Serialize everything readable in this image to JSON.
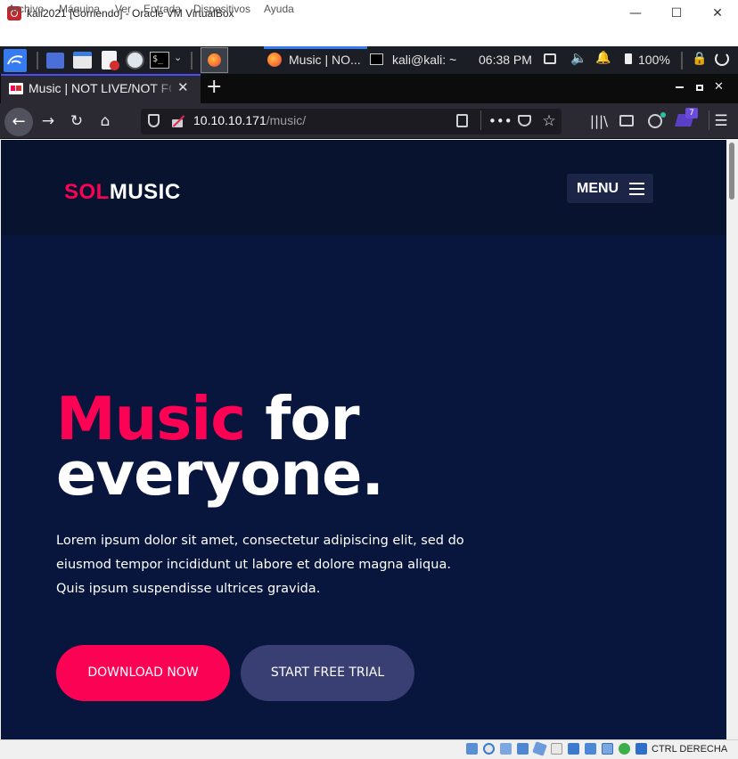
{
  "virtualbox": {
    "title": "kali2021 [Corriendo] - Oracle VM VirtualBox",
    "menu": [
      "Archivo",
      "Máquina",
      "Ver",
      "Entrada",
      "Dispositivos",
      "Ayuda"
    ],
    "host_key_label": "CTRL DERECHA"
  },
  "panel": {
    "task_firefox": "Music | NO...",
    "task_terminal": "kali@kali: ~",
    "clock": "06:38 PM",
    "battery": "100%",
    "notification_count": "7"
  },
  "browser": {
    "tab_title": "Music | NOT LIVE/NOT FOR PRODUCTION USE",
    "url_host": "10.10.10.171",
    "url_path": "/music/"
  },
  "site": {
    "logo_part1": "SOL",
    "logo_part2": "MUSIC",
    "menu_label": "MENU",
    "hero_highlight": "Music",
    "hero_title_rest1": " for",
    "hero_title_rest2": "everyone.",
    "hero_description": "Lorem ipsum dolor sit amet, consectetur adipiscing elit, sed do eiusmod tempor incididunt ut labore et dolore magna aliqua. Quis ipsum suspendisse ultrices gravida.",
    "download_button": "DOWNLOAD NOW",
    "trial_button": "START FREE TRIAL"
  },
  "colors": {
    "accent_pink": "#fc0254",
    "hero_background": "#08163e",
    "trial_button": "#393e73"
  }
}
